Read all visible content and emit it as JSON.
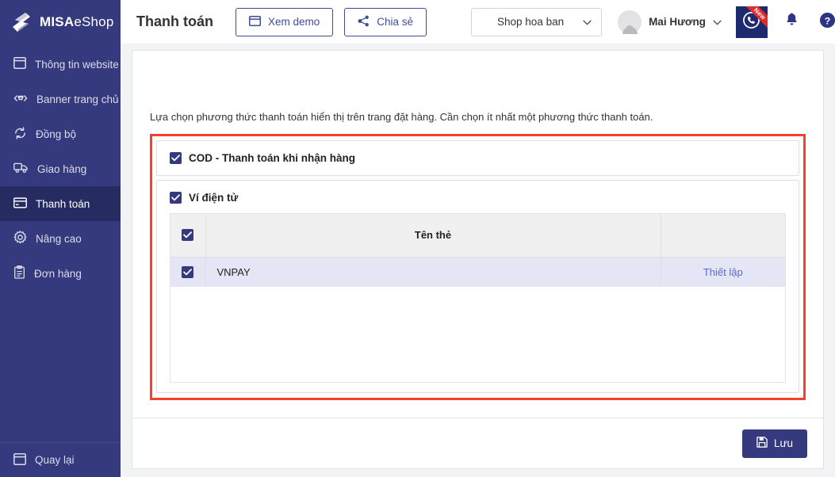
{
  "brand": {
    "name_bold": "MISA",
    "name_light": "eShop",
    "logo_icon": "misa-s-logo-icon"
  },
  "header": {
    "page_title": "Thanh toán",
    "view_demo": {
      "label": "Xem demo",
      "icon": "browser-window-icon"
    },
    "share": {
      "label": "Chia sẻ",
      "icon": "share-nodes-icon"
    },
    "shop_select": {
      "value": "Shop hoa ban",
      "icon": "chevron-down-icon"
    },
    "user": {
      "name": "Mai Hương",
      "icon": "chevron-down-icon",
      "avatar": "user-avatar-icon"
    },
    "support": {
      "icon": "phone-circle-icon",
      "badge": "New"
    },
    "notifications": {
      "icon": "bell-icon"
    },
    "help": {
      "icon": "question-circle-icon"
    }
  },
  "sidebar": {
    "items": [
      {
        "label": "Thông tin website",
        "icon": "window-icon",
        "active": false
      },
      {
        "label": "Banner trang chủ",
        "icon": "banner-icon",
        "active": false
      },
      {
        "label": "Đồng bộ",
        "icon": "sync-icon",
        "active": false
      },
      {
        "label": "Giao hàng",
        "icon": "truck-icon",
        "active": false
      },
      {
        "label": "Thanh toán",
        "icon": "credit-card-icon",
        "active": true
      },
      {
        "label": "Nâng cao",
        "icon": "gear-icon",
        "active": false
      },
      {
        "label": "Đơn hàng",
        "icon": "clipboard-icon",
        "active": false
      }
    ],
    "bottom": {
      "label": "Quay lại",
      "icon": "window-icon"
    }
  },
  "main": {
    "description": "Lựa chọn phương thức thanh toán hiển thị trên trang đặt hàng. Cần chọn ít nhất một phương thức thanh toán.",
    "payment_methods": [
      {
        "label": "COD - Thanh toán khi nhận hàng",
        "checked": true
      },
      {
        "label": "Ví điện tử",
        "checked": true
      }
    ],
    "wallet_table": {
      "select_all_checked": true,
      "columns": [
        "",
        "Tên thẻ",
        ""
      ],
      "header_name": "Tên thẻ",
      "rows": [
        {
          "checked": true,
          "name": "VNPAY",
          "action": "Thiết lập"
        }
      ]
    },
    "save_button": {
      "label": "Lưu",
      "icon": "save-disk-icon"
    }
  },
  "colors": {
    "brand_navy": "#343a7d",
    "sidebar_active": "#262b61",
    "annotation_red": "#f6402c",
    "link_blue": "#5b6ad0",
    "row_highlight": "#e4e6f5",
    "table_header": "#f0f0f0"
  }
}
